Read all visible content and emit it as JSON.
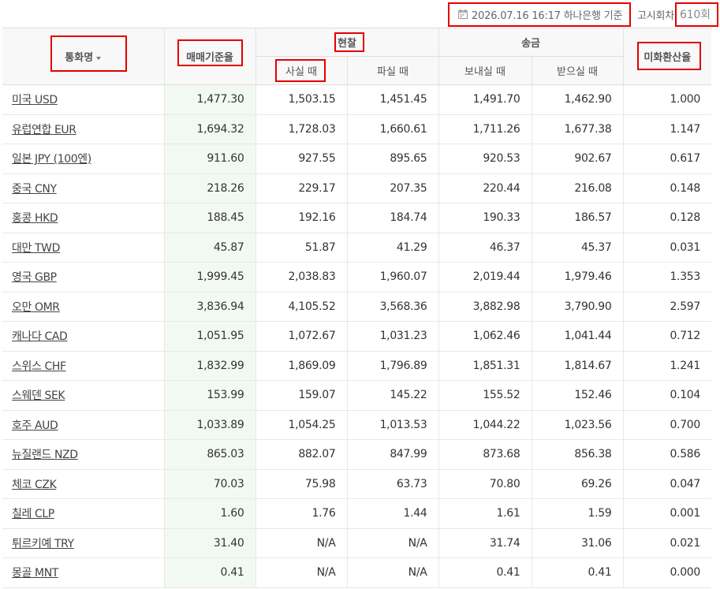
{
  "topbar": {
    "calendar_icon": "calendar-icon",
    "date_text": "2026.07.16 16:17  하나은행 기준",
    "round_label": "고시회차",
    "round_value": "610회"
  },
  "headers": {
    "currency": "통화명",
    "base_rate": "매매기준율",
    "cash": "현찰",
    "cash_buy": "사실 때",
    "cash_sell": "파실 때",
    "remit": "송금",
    "remit_send": "보내실 때",
    "remit_receive": "받으실 때",
    "usd_rate": "미화환산율"
  },
  "rows": [
    {
      "name": "미국 USD",
      "base": "1,477.30",
      "buy": "1,503.15",
      "sell": "1,451.45",
      "send": "1,491.70",
      "recv": "1,462.90",
      "usd": "1.000"
    },
    {
      "name": "유럽연합 EUR",
      "base": "1,694.32",
      "buy": "1,728.03",
      "sell": "1,660.61",
      "send": "1,711.26",
      "recv": "1,677.38",
      "usd": "1.147"
    },
    {
      "name": "일본 JPY (100엔)",
      "base": "911.60",
      "buy": "927.55",
      "sell": "895.65",
      "send": "920.53",
      "recv": "902.67",
      "usd": "0.617"
    },
    {
      "name": "중국 CNY",
      "base": "218.26",
      "buy": "229.17",
      "sell": "207.35",
      "send": "220.44",
      "recv": "216.08",
      "usd": "0.148"
    },
    {
      "name": "홍콩 HKD",
      "base": "188.45",
      "buy": "192.16",
      "sell": "184.74",
      "send": "190.33",
      "recv": "186.57",
      "usd": "0.128"
    },
    {
      "name": "대만 TWD",
      "base": "45.87",
      "buy": "51.87",
      "sell": "41.29",
      "send": "46.37",
      "recv": "45.37",
      "usd": "0.031"
    },
    {
      "name": "영국 GBP",
      "base": "1,999.45",
      "buy": "2,038.83",
      "sell": "1,960.07",
      "send": "2,019.44",
      "recv": "1,979.46",
      "usd": "1.353"
    },
    {
      "name": "오만 OMR",
      "base": "3,836.94",
      "buy": "4,105.52",
      "sell": "3,568.36",
      "send": "3,882.98",
      "recv": "3,790.90",
      "usd": "2.597"
    },
    {
      "name": "캐나다 CAD",
      "base": "1,051.95",
      "buy": "1,072.67",
      "sell": "1,031.23",
      "send": "1,062.46",
      "recv": "1,041.44",
      "usd": "0.712"
    },
    {
      "name": "스위스 CHF",
      "base": "1,832.99",
      "buy": "1,869.09",
      "sell": "1,796.89",
      "send": "1,851.31",
      "recv": "1,814.67",
      "usd": "1.241"
    },
    {
      "name": "스웨덴 SEK",
      "base": "153.99",
      "buy": "159.07",
      "sell": "145.22",
      "send": "155.52",
      "recv": "152.46",
      "usd": "0.104"
    },
    {
      "name": "호주 AUD",
      "base": "1,033.89",
      "buy": "1,054.25",
      "sell": "1,013.53",
      "send": "1,044.22",
      "recv": "1,023.56",
      "usd": "0.700"
    },
    {
      "name": "뉴질랜드 NZD",
      "base": "865.03",
      "buy": "882.07",
      "sell": "847.99",
      "send": "873.68",
      "recv": "856.38",
      "usd": "0.586"
    },
    {
      "name": "체코 CZK",
      "base": "70.03",
      "buy": "75.98",
      "sell": "63.73",
      "send": "70.80",
      "recv": "69.26",
      "usd": "0.047"
    },
    {
      "name": "칠레 CLP",
      "base": "1.60",
      "buy": "1.76",
      "sell": "1.44",
      "send": "1.61",
      "recv": "1.59",
      "usd": "0.001"
    },
    {
      "name": "튀르키예 TRY",
      "base": "31.40",
      "buy": "N/A",
      "sell": "N/A",
      "send": "31.74",
      "recv": "31.06",
      "usd": "0.021"
    },
    {
      "name": "몽골 MNT",
      "base": "0.41",
      "buy": "N/A",
      "sell": "N/A",
      "send": "0.41",
      "recv": "0.41",
      "usd": "0.000"
    }
  ]
}
